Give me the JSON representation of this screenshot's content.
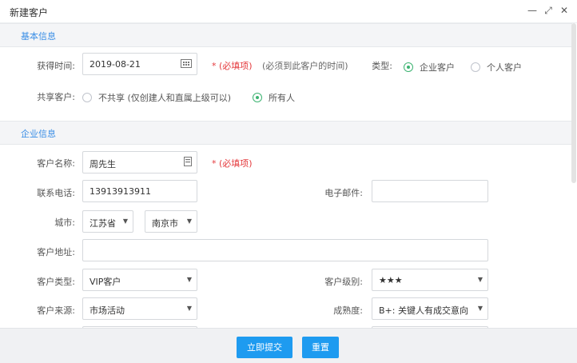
{
  "dialog": {
    "title": "新建客户",
    "minimize": "—",
    "maximize": "⤢",
    "close": "✕"
  },
  "basic": {
    "heading": "基本信息",
    "acquire_time_label": "获得时间:",
    "acquire_time_value": "2019-08-21",
    "required_text": "* (必填项)",
    "acquire_hint": "(必须到此客户的时间)",
    "type_label": "类型:",
    "type_options": [
      "企业客户",
      "个人客户"
    ],
    "type_selected": "企业客户",
    "share_label": "共享客户:",
    "share_options": [
      "不共享 (仅创建人和直属上级可以)",
      "所有人"
    ],
    "share_selected": "所有人"
  },
  "company": {
    "heading": "企业信息",
    "name_label": "客户名称:",
    "name_value": "周先生",
    "name_required": "* (必填项)",
    "phone_label": "联系电话:",
    "phone_value": "13913913911",
    "email_label": "电子邮件:",
    "email_value": "",
    "city_label": "城市:",
    "province_value": "江苏省",
    "city_value": "南京市",
    "address_label": "客户地址:",
    "address_value": "",
    "ctype_label": "客户类型:",
    "ctype_value": "VIP客户",
    "level_label": "客户级别:",
    "level_value": "★★★",
    "source_label": "客户来源:",
    "source_value": "市场活动",
    "maturity_label": "成熟度:",
    "maturity_value": "B+: 关键人有成交意向"
  },
  "footer": {
    "submit_label": "立即提交",
    "reset_label": "重置"
  },
  "colors": {
    "accent": "#1e9bf0",
    "link": "#3a8ee6",
    "required": "#e4393c",
    "radio_on": "#3cb371"
  },
  "icons": {
    "date": "calendar-icon",
    "card": "contact-card-icon"
  }
}
